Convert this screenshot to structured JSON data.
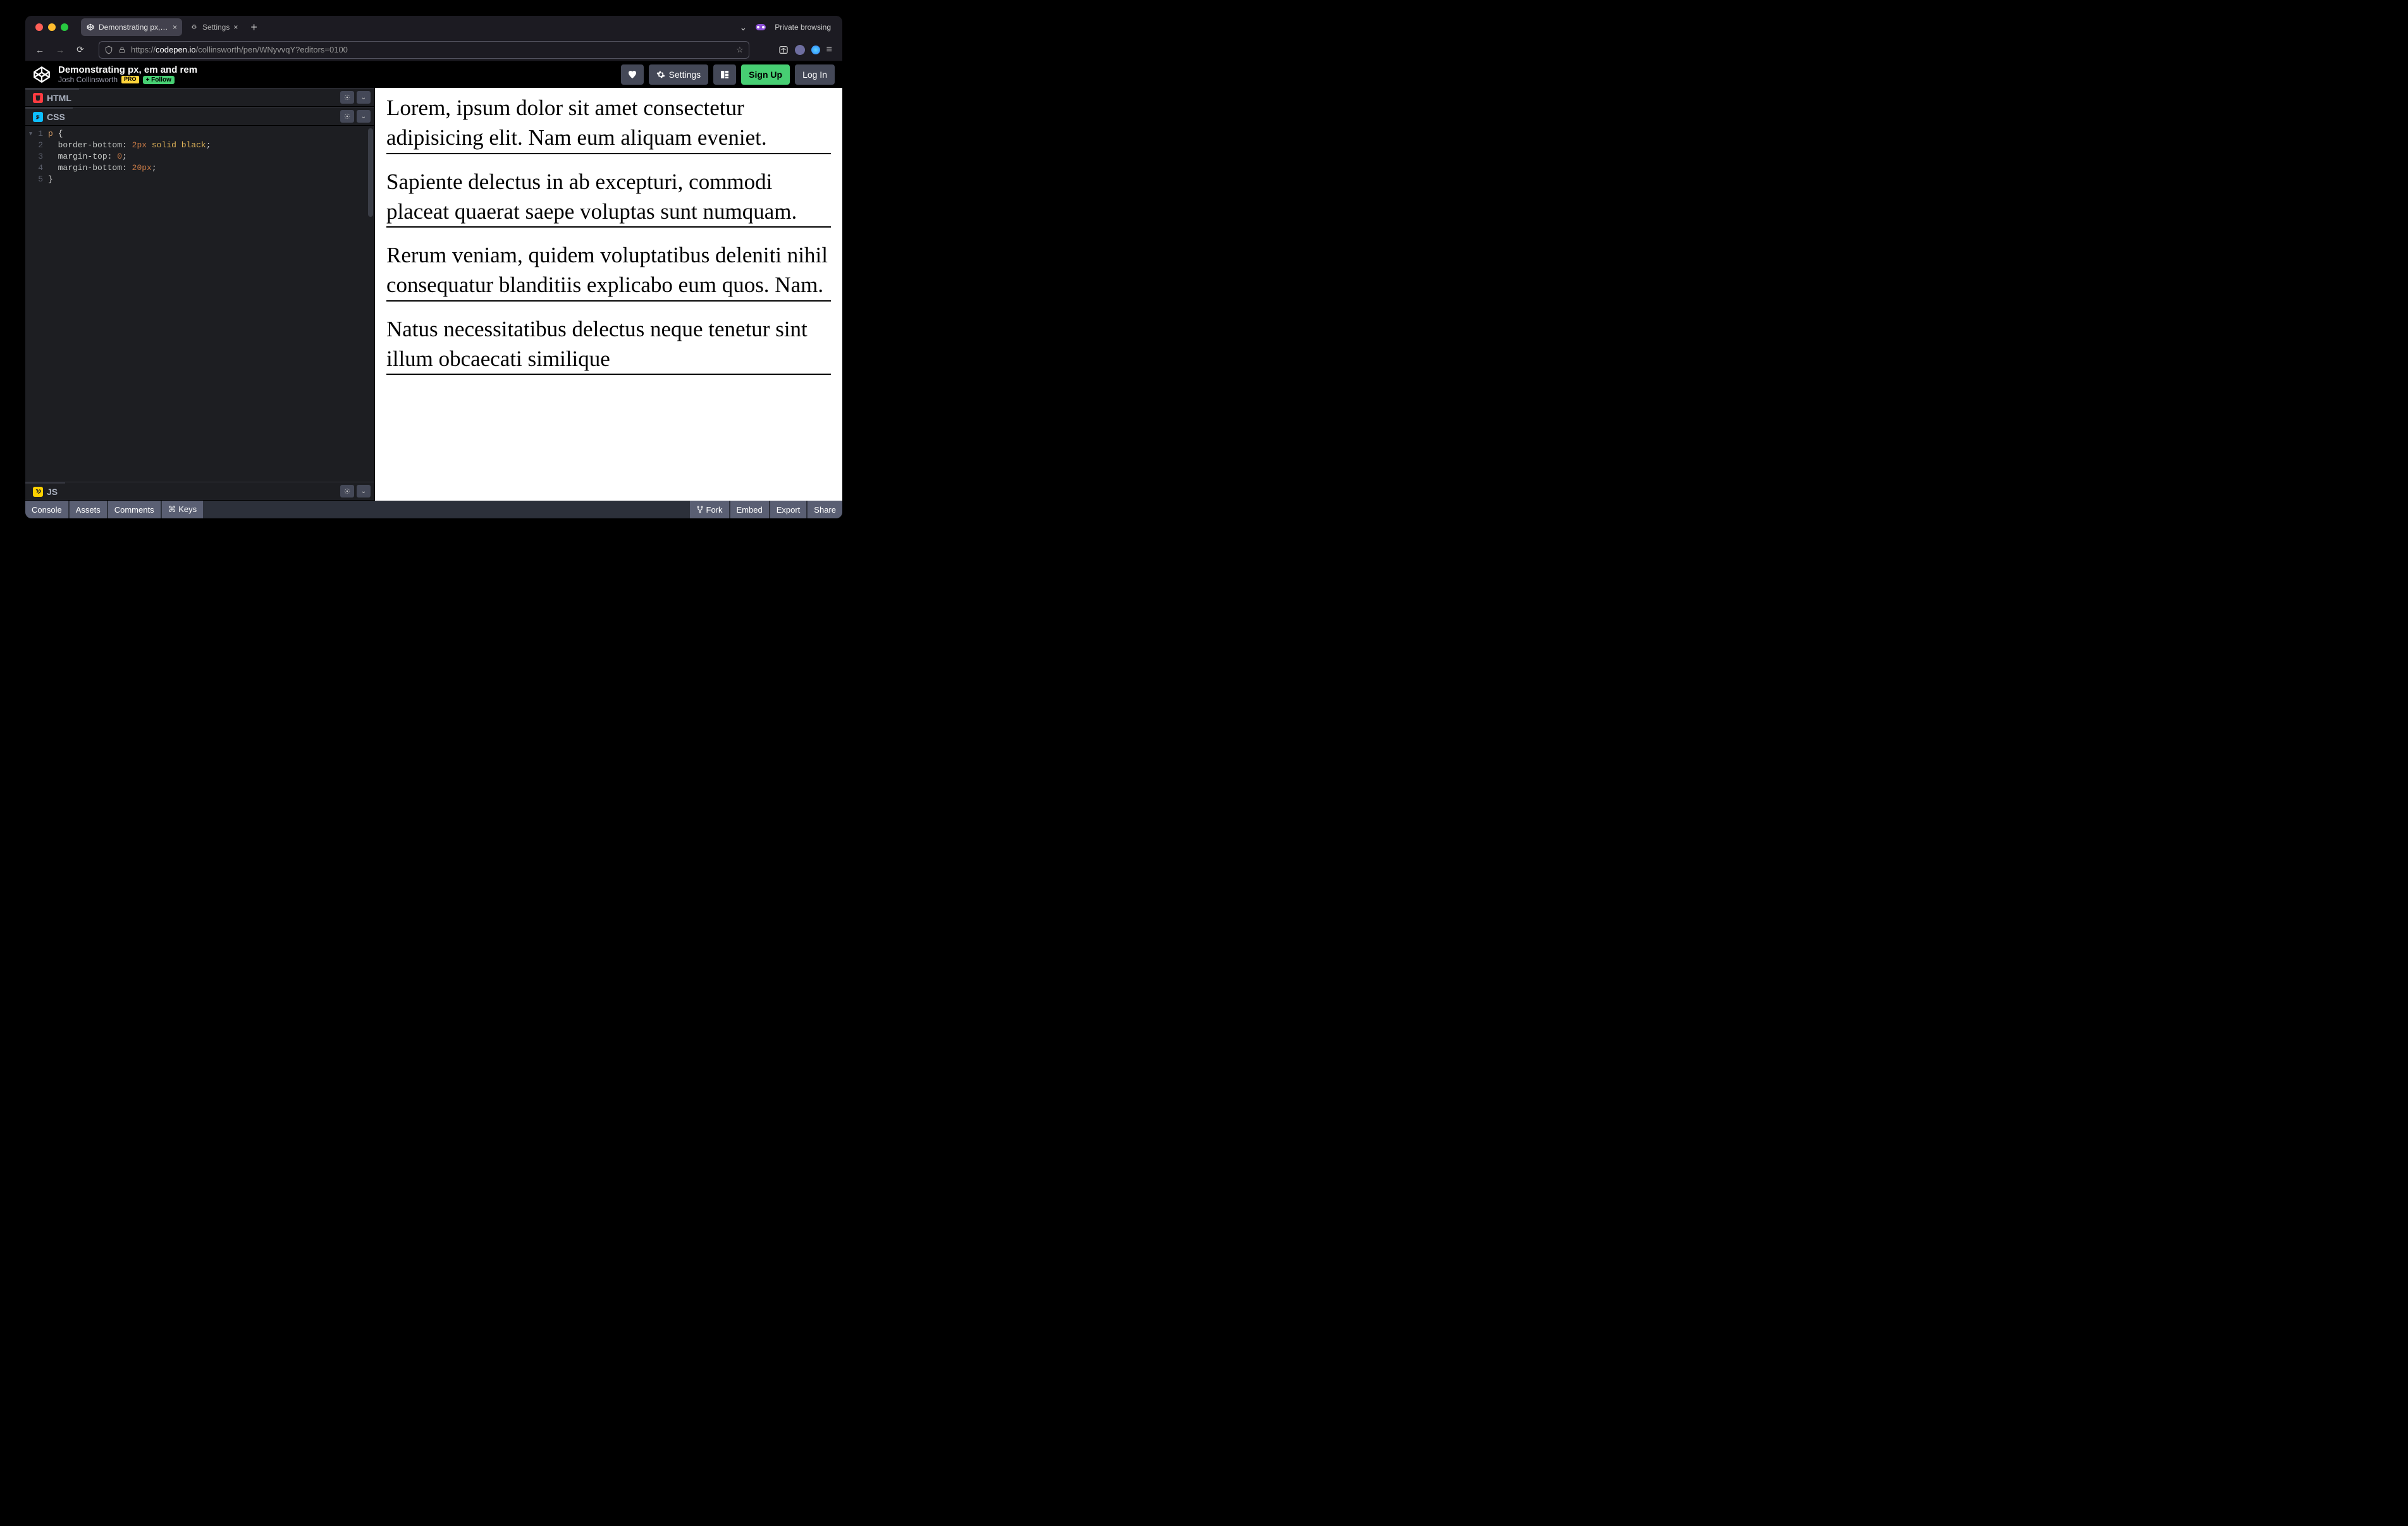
{
  "browser": {
    "tabs": [
      {
        "title": "Demonstrating px, em and rem",
        "active": true
      },
      {
        "title": "Settings",
        "active": false
      }
    ],
    "private_label": "Private browsing",
    "url_prefix": "https://",
    "url_domain": "codepen.io",
    "url_path": "/collinsworth/pen/WNyvvqY?editors=0100"
  },
  "codepen": {
    "title": "Demonstrating px, em and rem",
    "author": "Josh Collinsworth",
    "pro_label": "PRO",
    "follow_label": "+ Follow",
    "buttons": {
      "settings": "Settings",
      "signup": "Sign Up",
      "login": "Log In"
    },
    "panels": {
      "html": "HTML",
      "css": "CSS",
      "js": "JS"
    },
    "footer": {
      "console": "Console",
      "assets": "Assets",
      "comments": "Comments",
      "keys": "⌘ Keys",
      "fork": "Fork",
      "embed": "Embed",
      "export": "Export",
      "share": "Share"
    }
  },
  "code": {
    "css_lines": [
      {
        "n": 1,
        "fold": true,
        "tokens": [
          [
            "sel",
            "p"
          ],
          [
            "punc",
            " {"
          ]
        ]
      },
      {
        "n": 2,
        "tokens": [
          [
            "prop",
            "  border-bottom"
          ],
          [
            "punc",
            ": "
          ],
          [
            "num",
            "2px"
          ],
          [
            "punc",
            " "
          ],
          [
            "kw",
            "solid"
          ],
          [
            "punc",
            " "
          ],
          [
            "kw",
            "black"
          ],
          [
            "punc",
            ";"
          ]
        ]
      },
      {
        "n": 3,
        "tokens": [
          [
            "prop",
            "  margin-top"
          ],
          [
            "punc",
            ": "
          ],
          [
            "num",
            "0"
          ],
          [
            "punc",
            ";"
          ]
        ]
      },
      {
        "n": 4,
        "tokens": [
          [
            "prop",
            "  margin-bottom"
          ],
          [
            "punc",
            ": "
          ],
          [
            "num",
            "20px"
          ],
          [
            "punc",
            ";"
          ]
        ]
      },
      {
        "n": 5,
        "tokens": [
          [
            "punc",
            "}"
          ]
        ]
      }
    ]
  },
  "preview": {
    "paragraphs": [
      "Lorem, ipsum dolor sit amet consectetur adipisicing elit. Nam eum aliquam eveniet.",
      "Sapiente delectus in ab excepturi, commodi placeat quaerat saepe voluptas sunt numquam.",
      "Rerum veniam, quidem voluptatibus deleniti nihil consequatur blanditiis explicabo eum quos. Nam.",
      "Natus necessitatibus delectus neque tenetur sint illum obcaecati similique"
    ]
  }
}
